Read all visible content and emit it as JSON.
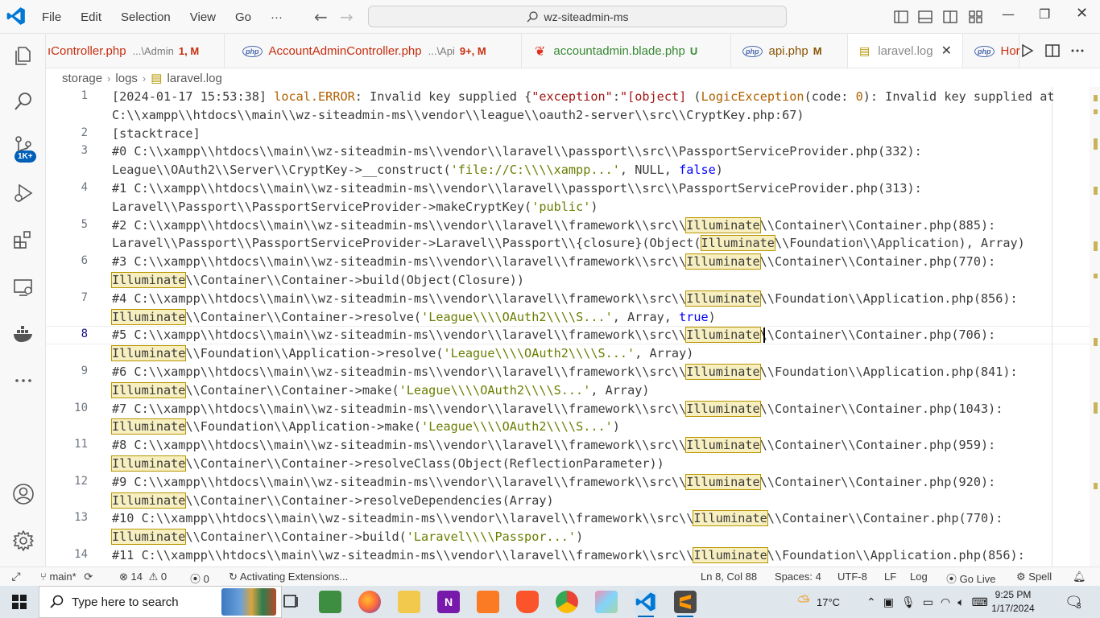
{
  "titlebar": {
    "menu": [
      "File",
      "Edit",
      "Selection",
      "View",
      "Go"
    ],
    "more": "···",
    "search": "wz-siteadmin-ms"
  },
  "activity": {
    "badge": "1K+"
  },
  "tabs": [
    {
      "name": "ıController.php",
      "desc": "...\\Admin",
      "status": "1, M",
      "color": "#c72e0f"
    },
    {
      "name": "AccountAdminController.php",
      "desc": "...\\Api",
      "status": "9+, M",
      "color": "#c72e0f"
    },
    {
      "name": "accountadmin.blade.php",
      "desc": "",
      "status": "U",
      "color": "#388a34"
    },
    {
      "name": "api.php",
      "desc": "",
      "status": "M",
      "color": "#895503"
    },
    {
      "name": "laravel.log",
      "desc": "",
      "status": "",
      "color": "#8a8a8a"
    },
    {
      "name": "Hor",
      "desc": "",
      "status": "",
      "color": "#c72e0f"
    }
  ],
  "breadcrumb": [
    "storage",
    "logs",
    "laravel.log"
  ],
  "editor": {
    "current_line": "8",
    "lines": [
      {
        "n": "1",
        "rows": [
          [
            [
              "[2024-01-17 15:53:38] ",
              ""
            ],
            [
              "local.ERROR",
              "lvl"
            ],
            [
              ": Invalid key supplied {",
              ""
            ],
            [
              "\"exception\"",
              "str"
            ],
            [
              ":",
              ""
            ],
            [
              "\"[object] ",
              "str"
            ],
            [
              "(",
              ""
            ],
            [
              "LogicException",
              "lvl"
            ],
            [
              "(code: ",
              ""
            ],
            [
              "0",
              "lvl"
            ],
            [
              "): Invalid key supplied at",
              ""
            ]
          ],
          [
            [
              "C:\\\\xampp\\\\htdocs\\\\main\\\\wz-siteadmin-ms\\\\vendor\\\\league\\\\oauth2-server\\\\src\\\\CryptKey.php:67)",
              ""
            ]
          ]
        ]
      },
      {
        "n": "2",
        "rows": [
          [
            [
              "[stacktrace]",
              ""
            ]
          ]
        ]
      },
      {
        "n": "3",
        "rows": [
          [
            [
              "#0 C:\\\\xampp\\\\htdocs\\\\main\\\\wz-siteadmin-ms\\\\vendor\\\\laravel\\\\passport\\\\src\\\\PassportServiceProvider.php(332):",
              ""
            ]
          ],
          [
            [
              "League\\\\OAuth2\\\\Server\\\\CryptKey->__construct(",
              ""
            ],
            [
              "'file://C:\\\\\\\\xampp...'",
              "str2"
            ],
            [
              ", NULL, ",
              ""
            ],
            [
              "false",
              "kw"
            ],
            [
              ")",
              ""
            ]
          ]
        ]
      },
      {
        "n": "4",
        "rows": [
          [
            [
              "#1 C:\\\\xampp\\\\htdocs\\\\main\\\\wz-siteadmin-ms\\\\vendor\\\\laravel\\\\passport\\\\src\\\\PassportServiceProvider.php(313):",
              ""
            ]
          ],
          [
            [
              "Laravel\\\\Passport\\\\PassportServiceProvider->makeCryptKey(",
              ""
            ],
            [
              "'public'",
              "str2"
            ],
            [
              ")",
              ""
            ]
          ]
        ]
      },
      {
        "n": "5",
        "rows": [
          [
            [
              "#2 C:\\\\xampp\\\\htdocs\\\\main\\\\wz-siteadmin-ms\\\\vendor\\\\laravel\\\\framework\\\\src\\\\",
              ""
            ],
            [
              "Illuminate",
              "hl"
            ],
            [
              "\\\\Container\\\\Container.php(885):",
              ""
            ]
          ],
          [
            [
              "Laravel\\\\Passport\\\\PassportServiceProvider->Laravel\\\\Passport\\\\{closure}(Object(",
              ""
            ],
            [
              "Illuminate",
              "hl"
            ],
            [
              "\\\\Foundation\\\\Application), Array)",
              ""
            ]
          ]
        ]
      },
      {
        "n": "6",
        "rows": [
          [
            [
              "#3 C:\\\\xampp\\\\htdocs\\\\main\\\\wz-siteadmin-ms\\\\vendor\\\\laravel\\\\framework\\\\src\\\\",
              ""
            ],
            [
              "Illuminate",
              "hl"
            ],
            [
              "\\\\Container\\\\Container.php(770):",
              ""
            ]
          ],
          [
            [
              "Illuminate",
              "hl"
            ],
            [
              "\\\\Container\\\\Container->build(Object(Closure))",
              ""
            ]
          ]
        ]
      },
      {
        "n": "7",
        "rows": [
          [
            [
              "#4 C:\\\\xampp\\\\htdocs\\\\main\\\\wz-siteadmin-ms\\\\vendor\\\\laravel\\\\framework\\\\src\\\\",
              ""
            ],
            [
              "Illuminate",
              "hl"
            ],
            [
              "\\\\Foundation\\\\Application.php(856):",
              ""
            ]
          ],
          [
            [
              "Illuminate",
              "hl"
            ],
            [
              "\\\\Container\\\\Container->resolve(",
              ""
            ],
            [
              "'League\\\\\\\\OAuth2\\\\\\\\S...'",
              "str2"
            ],
            [
              ", Array, ",
              ""
            ],
            [
              "true",
              "kw"
            ],
            [
              ")",
              ""
            ]
          ]
        ]
      },
      {
        "n": "8",
        "rows": [
          [
            [
              "#5 C:\\\\xampp\\\\htdocs\\\\main\\\\wz-siteadmin-ms\\\\vendor\\\\laravel\\\\framework\\\\src\\\\",
              ""
            ],
            [
              "Illuminate",
              "hl"
            ],
            [
              "\\\\Container\\\\Container.php(706):",
              ""
            ]
          ],
          [
            [
              "Illuminate",
              "hl"
            ],
            [
              "\\\\Foundation\\\\Application->resolve(",
              ""
            ],
            [
              "'League\\\\\\\\OAuth2\\\\\\\\S...'",
              "str2"
            ],
            [
              ", Array)",
              ""
            ]
          ]
        ]
      },
      {
        "n": "9",
        "rows": [
          [
            [
              "#6 C:\\\\xampp\\\\htdocs\\\\main\\\\wz-siteadmin-ms\\\\vendor\\\\laravel\\\\framework\\\\src\\\\",
              ""
            ],
            [
              "Illuminate",
              "hl"
            ],
            [
              "\\\\Foundation\\\\Application.php(841):",
              ""
            ]
          ],
          [
            [
              "Illuminate",
              "hl"
            ],
            [
              "\\\\Container\\\\Container->make(",
              ""
            ],
            [
              "'League\\\\\\\\OAuth2\\\\\\\\S...'",
              "str2"
            ],
            [
              ", Array)",
              ""
            ]
          ]
        ]
      },
      {
        "n": "10",
        "rows": [
          [
            [
              "#7 C:\\\\xampp\\\\htdocs\\\\main\\\\wz-siteadmin-ms\\\\vendor\\\\laravel\\\\framework\\\\src\\\\",
              ""
            ],
            [
              "Illuminate",
              "hl"
            ],
            [
              "\\\\Container\\\\Container.php(1043):",
              ""
            ]
          ],
          [
            [
              "Illuminate",
              "hl"
            ],
            [
              "\\\\Foundation\\\\Application->make(",
              ""
            ],
            [
              "'League\\\\\\\\OAuth2\\\\\\\\S...'",
              "str2"
            ],
            [
              ")",
              ""
            ]
          ]
        ]
      },
      {
        "n": "11",
        "rows": [
          [
            [
              "#8 C:\\\\xampp\\\\htdocs\\\\main\\\\wz-siteadmin-ms\\\\vendor\\\\laravel\\\\framework\\\\src\\\\",
              ""
            ],
            [
              "Illuminate",
              "hl"
            ],
            [
              "\\\\Container\\\\Container.php(959):",
              ""
            ]
          ],
          [
            [
              "Illuminate",
              "hl"
            ],
            [
              "\\\\Container\\\\Container->resolveClass(Object(ReflectionParameter))",
              ""
            ]
          ]
        ]
      },
      {
        "n": "12",
        "rows": [
          [
            [
              "#9 C:\\\\xampp\\\\htdocs\\\\main\\\\wz-siteadmin-ms\\\\vendor\\\\laravel\\\\framework\\\\src\\\\",
              ""
            ],
            [
              "Illuminate",
              "hl"
            ],
            [
              "\\\\Container\\\\Container.php(920):",
              ""
            ]
          ],
          [
            [
              "Illuminate",
              "hl"
            ],
            [
              "\\\\Container\\\\Container->resolveDependencies(Array)",
              ""
            ]
          ]
        ]
      },
      {
        "n": "13",
        "rows": [
          [
            [
              "#10 C:\\\\xampp\\\\htdocs\\\\main\\\\wz-siteadmin-ms\\\\vendor\\\\laravel\\\\framework\\\\src\\\\",
              ""
            ],
            [
              "Illuminate",
              "hl"
            ],
            [
              "\\\\Container\\\\Container.php(770):",
              ""
            ]
          ],
          [
            [
              "Illuminate",
              "hl"
            ],
            [
              "\\\\Container\\\\Container->build(",
              ""
            ],
            [
              "'Laravel\\\\\\\\Passpor...'",
              "str2"
            ],
            [
              ")",
              ""
            ]
          ]
        ]
      },
      {
        "n": "14",
        "rows": [
          [
            [
              "#11 C:\\\\xampp\\\\htdocs\\\\main\\\\wz-siteadmin-ms\\\\vendor\\\\laravel\\\\framework\\\\src\\\\",
              ""
            ],
            [
              "Illuminate",
              "hl"
            ],
            [
              "\\\\Foundation\\\\Application.php(856):",
              ""
            ]
          ]
        ]
      }
    ]
  },
  "statusbar": {
    "branch": "main*",
    "errors": "14",
    "warnings": "0",
    "ports": "0",
    "activity": "Activating Extensions...",
    "position": "Ln 8, Col 88",
    "spaces": "Spaces: 4",
    "encoding": "UTF-8",
    "eol": "LF",
    "language": "Log",
    "golive": "Go Live",
    "spell": "Spell"
  },
  "taskbar": {
    "search_placeholder": "Type here to search",
    "weather": "17°C",
    "time": "9:25 PM",
    "date": "1/17/2024",
    "notifications": "3"
  }
}
